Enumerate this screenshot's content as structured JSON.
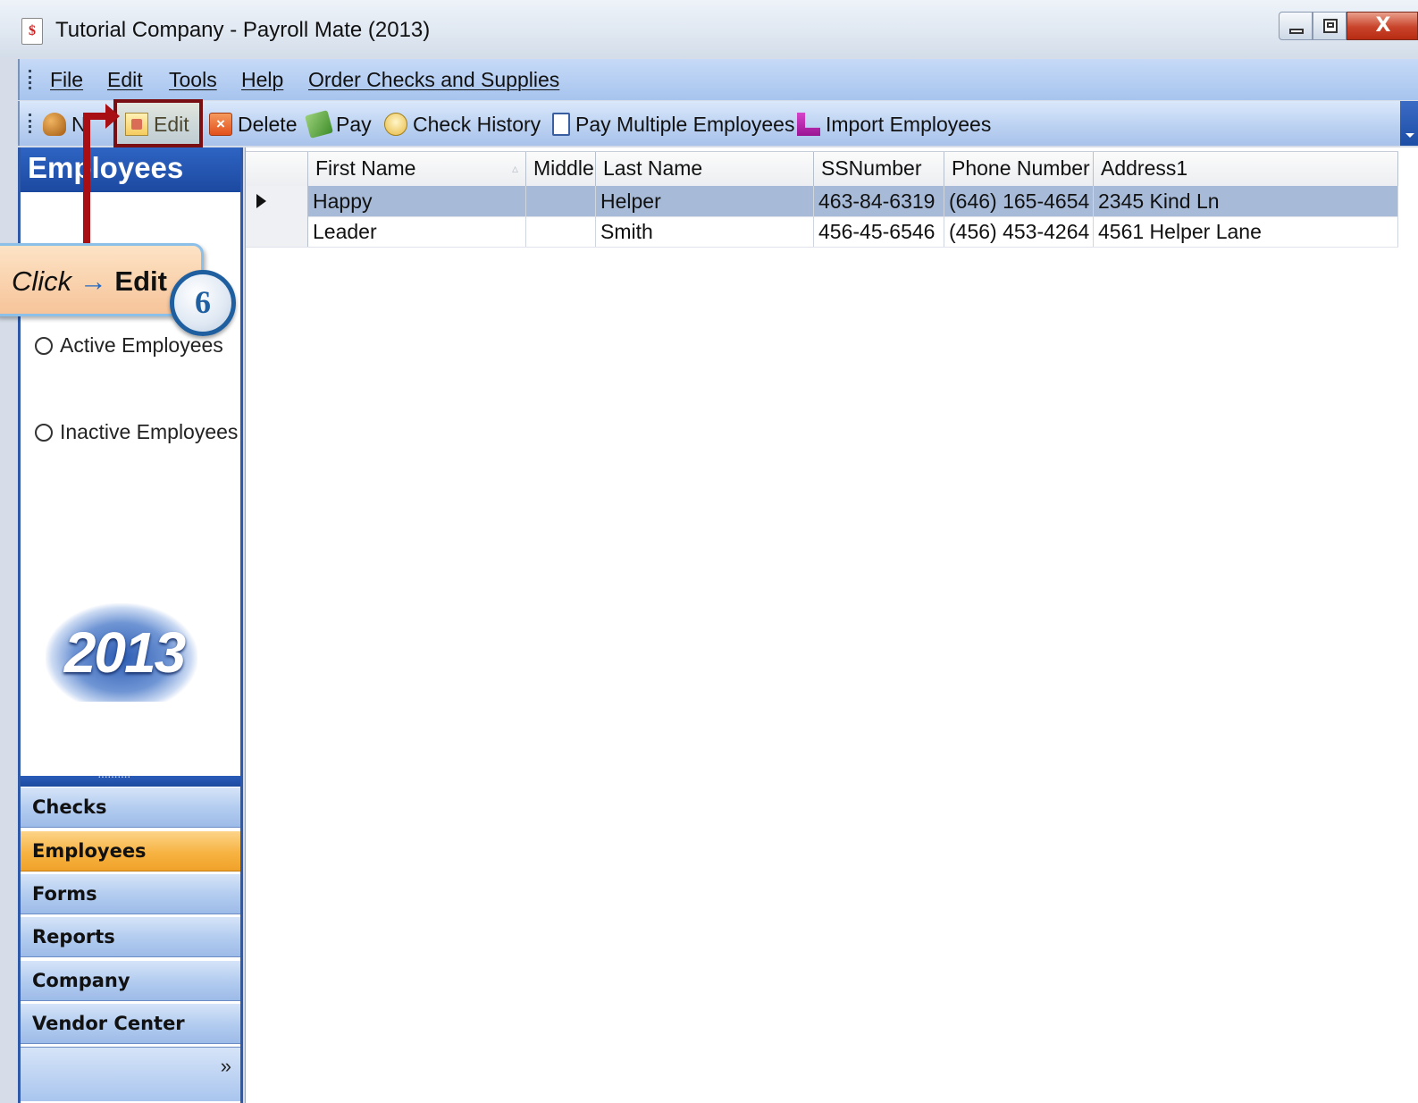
{
  "window": {
    "title": "Tutorial Company - Payroll Mate (2013)",
    "controls": {
      "close_glyph": "X"
    }
  },
  "menu": {
    "items": [
      "File",
      "Edit",
      "Tools",
      "Help",
      "Order Checks and Supplies"
    ]
  },
  "toolbar": {
    "new_label": "New",
    "new_visible_label": "N",
    "edit_label": "Edit",
    "delete_label": "Delete",
    "delete_glyph": "×",
    "pay_label": "Pay",
    "check_history_label": "Check History",
    "pay_multiple_label": "Pay Multiple Employees",
    "import_label": "Import Employees"
  },
  "sidebar": {
    "header": "Employees",
    "filters": [
      "Active Employees",
      "Inactive Employees"
    ],
    "logo_text": "2013",
    "nav": [
      {
        "label": "Checks",
        "active": false
      },
      {
        "label": "Employees",
        "active": true
      },
      {
        "label": "Forms",
        "active": false
      },
      {
        "label": "Reports",
        "active": false
      },
      {
        "label": "Company",
        "active": false
      },
      {
        "label": "Vendor Center",
        "active": false
      }
    ],
    "overflow_glyph": "»"
  },
  "grid": {
    "columns": [
      "First Name",
      "Middle",
      "Last Name",
      "SSNumber",
      "Phone Number",
      "Address1"
    ],
    "sort_glyph": "▵",
    "rows": [
      {
        "first": "Happy",
        "middle": "",
        "last": "Helper",
        "ssn": "463-84-6319",
        "phone": "(646) 165-4654",
        "address": "2345 Kind Ln",
        "selected": true
      },
      {
        "first": "Leader",
        "middle": "",
        "last": "Smith",
        "ssn": "456-45-6546",
        "phone": "(456) 453-4264",
        "address": "4561 Helper Lane",
        "selected": false
      }
    ]
  },
  "callout": {
    "action": "Click",
    "arrow": "→",
    "target": "Edit",
    "step": "6"
  },
  "colors": {
    "highlight": "#7a0f13",
    "active_nav": "#f7b342",
    "header_blue": "#1c49a0",
    "selected_row": "#a7bbd9"
  }
}
